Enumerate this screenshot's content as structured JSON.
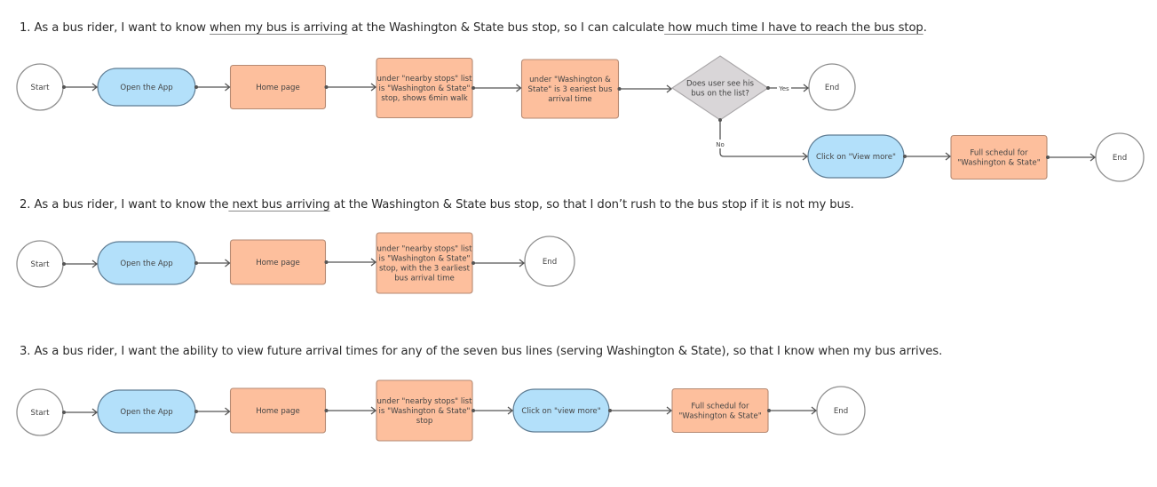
{
  "stories": [
    {
      "parts": [
        {
          "text": "1. As a bus rider, I want to know ",
          "underline": false
        },
        {
          "text": "when my bus is arriving",
          "underline": true
        },
        {
          "text": " at the Washington & State bus stop, so I can calculate",
          "underline": false
        },
        {
          "text": " how much time I have to reach the bus stop",
          "underline": true
        },
        {
          "text": ".",
          "underline": false
        }
      ]
    },
    {
      "parts": [
        {
          "text": "2. As a bus rider, I want to know the",
          "underline": false
        },
        {
          "text": " next bus arriving",
          "underline": true
        },
        {
          "text": " at the Washington & State bus stop, so that I don’t rush to the bus stop if it is not my bus.",
          "underline": false
        }
      ]
    },
    {
      "parts": [
        {
          "text": "3. As a bus rider, I want the ability to view future arrival times for any of the seven bus lines (serving Washington & State), so that I know when my bus arrives.",
          "underline": false
        }
      ]
    }
  ],
  "colors": {
    "terminal_fill": "#ffffff",
    "action_fill": "#b3e0fa",
    "screen_fill": "#fdbf9d",
    "decision_fill": "#d9d6d8",
    "connector": "#555555"
  },
  "flows": [
    {
      "nodes": [
        {
          "id": "start",
          "type": "terminal",
          "lines": [
            "Start"
          ]
        },
        {
          "id": "open-app",
          "type": "action",
          "lines": [
            "Open the App"
          ]
        },
        {
          "id": "home",
          "type": "screen",
          "lines": [
            "Home page"
          ]
        },
        {
          "id": "nearby",
          "type": "screen",
          "lines": [
            "under \"nearby stops\" list",
            "is \"Washington & State\"",
            "stop, shows 6min walk"
          ]
        },
        {
          "id": "earliest",
          "type": "screen",
          "lines": [
            "under \"Washington &",
            "State\" is 3 eariest bus",
            "arrival time"
          ]
        },
        {
          "id": "decision",
          "type": "decision",
          "lines": [
            "Does user see his",
            "bus on the list?"
          ]
        },
        {
          "id": "end-yes",
          "type": "terminal",
          "lines": [
            "End"
          ]
        },
        {
          "id": "view-more",
          "type": "action",
          "lines": [
            "Click on \"View more\""
          ]
        },
        {
          "id": "full-schedule",
          "type": "screen",
          "lines": [
            "Full schedul for",
            "\"Washington & State\""
          ]
        },
        {
          "id": "end-no",
          "type": "terminal",
          "lines": [
            "End"
          ]
        }
      ],
      "edge_labels": {
        "yes": "Yes",
        "no": "No"
      }
    },
    {
      "nodes": [
        {
          "id": "start",
          "type": "terminal",
          "lines": [
            "Start"
          ]
        },
        {
          "id": "open-app",
          "type": "action",
          "lines": [
            "Open the App"
          ]
        },
        {
          "id": "home",
          "type": "screen",
          "lines": [
            "Home page"
          ]
        },
        {
          "id": "nearby",
          "type": "screen",
          "lines": [
            "under \"nearby stops\" list",
            "is \"Washington & State\"",
            "stop, with the 3 earliest",
            "bus arrival time"
          ]
        },
        {
          "id": "end",
          "type": "terminal",
          "lines": [
            "End"
          ]
        }
      ]
    },
    {
      "nodes": [
        {
          "id": "start",
          "type": "terminal",
          "lines": [
            "Start"
          ]
        },
        {
          "id": "open-app",
          "type": "action",
          "lines": [
            "Open the App"
          ]
        },
        {
          "id": "home",
          "type": "screen",
          "lines": [
            "Home page"
          ]
        },
        {
          "id": "nearby",
          "type": "screen",
          "lines": [
            "under \"nearby stops\" list",
            "is \"Washington & State\"",
            "stop"
          ]
        },
        {
          "id": "view-more",
          "type": "action",
          "lines": [
            "Click on \"view more\""
          ]
        },
        {
          "id": "full-schedule",
          "type": "screen",
          "lines": [
            "Full schedul for",
            "\"Washington & State\""
          ]
        },
        {
          "id": "end",
          "type": "terminal",
          "lines": [
            "End"
          ]
        }
      ]
    }
  ]
}
